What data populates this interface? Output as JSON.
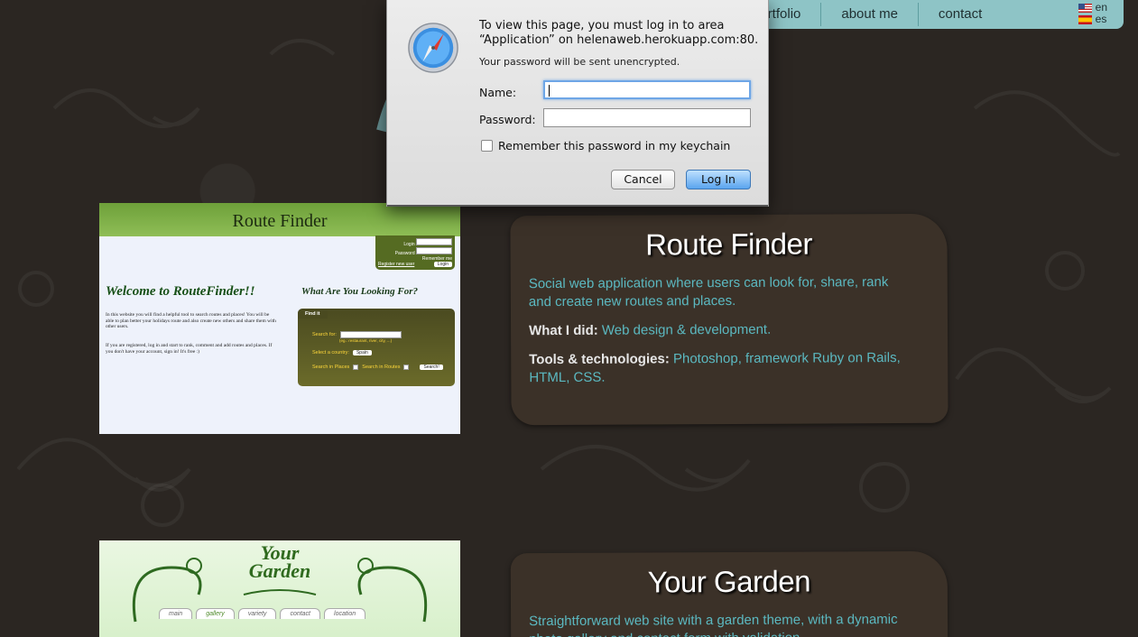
{
  "nav": {
    "links": [
      "portfolio",
      "about me",
      "contact"
    ],
    "languages": [
      {
        "flag": "us-flag-icon",
        "code": "en"
      },
      {
        "flag": "es-flag-icon",
        "code": "es"
      }
    ],
    "bar_color": "#8ec4c6"
  },
  "dialog": {
    "message": "To view this page, you must log in to area “Application” on helenaweb.herokuapp.com:80.",
    "subtext": "Your password will be sent unencrypted.",
    "name_label": "Name:",
    "password_label": "Password:",
    "name_value": "",
    "password_value": "",
    "remember_label": "Remember this password in my keychain",
    "remember_checked": false,
    "cancel_label": "Cancel",
    "login_label": "Log In",
    "icon": "safari-compass-icon"
  },
  "projects": [
    {
      "title": "Route Finder",
      "description": "Social web application where users can look for, share, rank and create new routes and places.",
      "what_label": "What I did:",
      "what_value": "Web design & development.",
      "tools_label": "Tools & technologies:",
      "tools_value": "Photoshop, framework Ruby on Rails, HTML, CSS.",
      "screenshot": {
        "header": "Route Finder",
        "login_labels": [
          "Login",
          "Password",
          "Remember me"
        ],
        "login_button": "Login",
        "register_link": "Register new user",
        "welcome": "Welcome to RouteFinder!!",
        "looking": "What Are You Looking For?",
        "para1": "In this website you will find a helpful tool to search routes and places! You will be able to plan better your holidays route and also create new others and share them with other users.",
        "para2": "If you are registered, log in and start to rank, comment and add routes and places. If you don't have your account, sign in! It's free :)",
        "find_tab": "Find it",
        "search_for": "Search for:",
        "search_hint": "(eg.: restaurant, river, city, ...)",
        "select_country": "Select a country:",
        "country": "Spain",
        "search_places": "Search in Places",
        "search_routes": "Search in Routes",
        "search_button": "Search!"
      }
    },
    {
      "title": "Your Garden",
      "description": "Straightforward web site with a garden theme, with a dynamic photo gallery and contact form with validation.",
      "screenshot": {
        "title_line1": "Your",
        "title_line2": "Garden",
        "tabs": [
          "main",
          "gallery",
          "variety",
          "contact",
          "location"
        ],
        "active_tab": "gallery"
      }
    }
  ],
  "colors": {
    "background": "#2b2622",
    "card": "#3b3128",
    "accent_text": "#5bb8c0"
  }
}
